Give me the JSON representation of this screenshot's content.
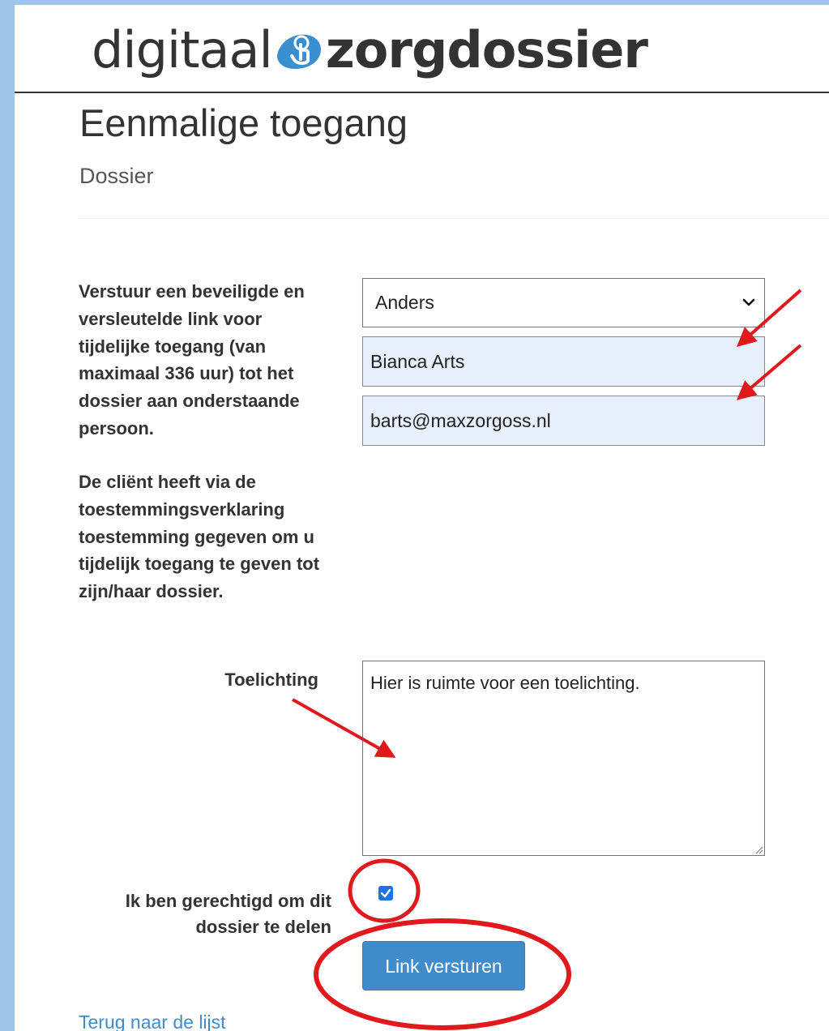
{
  "logo": {
    "part1": "digitaal",
    "part2": "zorgdossier",
    "icon": "hand-touch-icon",
    "icon_color": "#3a8fd1"
  },
  "header": {
    "title": "Eenmalige toegang",
    "subtitle": "Dossier"
  },
  "form": {
    "intro_text": "Verstuur een beveiligde en versleutelde link voor tijdelijke toegang (van maximaal 336 uur) tot het dossier aan onderstaande persoon.",
    "consent_text": "De cliënt heeft via de toestemmingsverklaring toestemming gegeven om u tijdelijk toegang te geven tot zijn/haar dossier.",
    "recipient_select": {
      "selected": "Anders"
    },
    "name_value": "Bianca Arts",
    "email_value": "barts@maxzorgoss.nl",
    "explanation_label": "Toelichting",
    "explanation_value": "Hier is ruimte voor een toelichting.",
    "authorized_label": "Ik ben gerechtigd om dit dossier te delen",
    "authorized_checked": true,
    "submit_label": "Link versturen"
  },
  "footer": {
    "back_link": "Terug naar de lijst"
  },
  "colors": {
    "background": "#9fc5e8",
    "primary_button": "#428bca",
    "link": "#428bca",
    "annotation_red": "#e0191c",
    "autofill_field": "#e8f0fe",
    "checkbox": "#1a73e8"
  }
}
